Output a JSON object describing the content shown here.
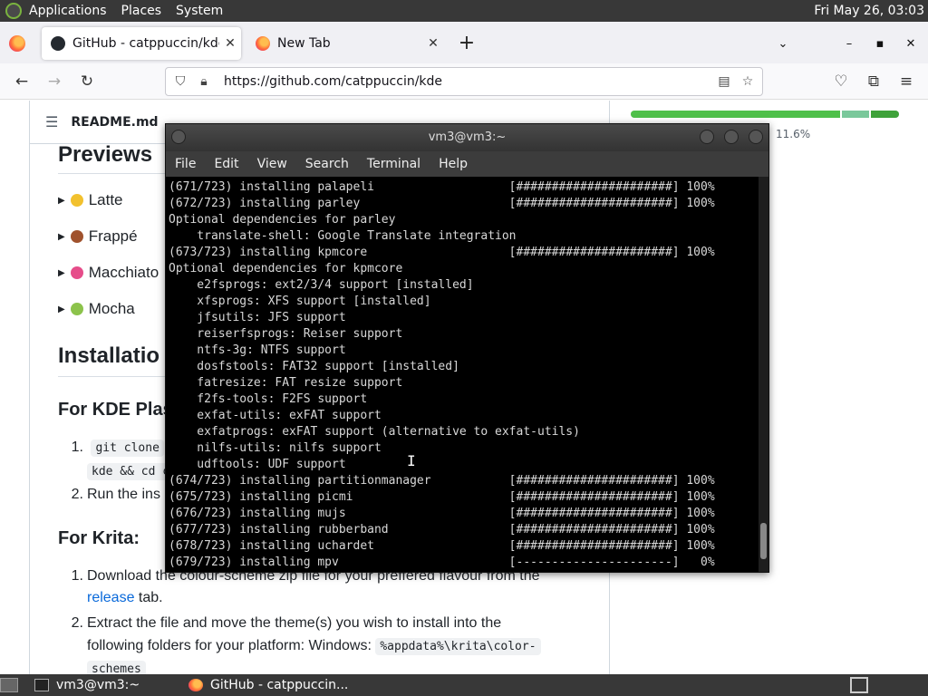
{
  "top_panel": {
    "menus": [
      "Applications",
      "Places",
      "System"
    ],
    "clock": "Fri May 26, 03:03"
  },
  "browser": {
    "tabs": [
      {
        "label": "GitHub - catppuccin/kde: 🌻",
        "active": true
      },
      {
        "label": "New Tab",
        "active": false
      }
    ],
    "url": "https://github.com/catppuccin/kde"
  },
  "readme": {
    "filename": "README.md",
    "progress_pct_text": "11.6%",
    "progress_segments": [
      {
        "color": "#4fc04a",
        "fraction": 0.78
      },
      {
        "color": "#7ac89b",
        "fraction": 0.11
      },
      {
        "color": "#3fa23a",
        "fraction": 0.11
      }
    ],
    "previews_heading": "Previews",
    "flavours": [
      {
        "name": "Latte",
        "emoji_color": "#f2c12e"
      },
      {
        "name": "Frappé",
        "emoji_color": "#a0522d"
      },
      {
        "name": "Macchiato",
        "emoji_color": "#e64d8a"
      },
      {
        "name": "Mocha",
        "emoji_color": "#8cc34b"
      }
    ],
    "installation_heading": "Installatio",
    "kde_heading": "For KDE Plas",
    "kde_steps": {
      "step1_num": "1.",
      "step1_code_a": "git clone",
      "step1_code_b": "kde && cd c",
      "step2_num": "2.",
      "step2_text": "Run the ins"
    },
    "krita_heading": "For Krita:",
    "krita_steps": {
      "step1_num": "1.",
      "step1_line1": "Download the colour-scheme zip file for your preffered flavour from the",
      "step1_link": "release",
      "step1_tail": " tab.",
      "step2_num": "2.",
      "step2_line1": "Extract the file and move the theme(s) you wish to install into the",
      "step2_line2": "following folders for your platform: Windows: ",
      "step2_code1": "%appdata%\\krita\\color-",
      "step2_code2": "schemes"
    }
  },
  "terminal": {
    "title": "vm3@vm3:~",
    "menus": [
      "File",
      "Edit",
      "View",
      "Search",
      "Terminal",
      "Help"
    ],
    "lines": [
      "(671/723) installing palapeli                   [######################] 100%",
      "(672/723) installing parley                     [######################] 100%",
      "Optional dependencies for parley",
      "    translate-shell: Google Translate integration",
      "(673/723) installing kpmcore                    [######################] 100%",
      "Optional dependencies for kpmcore",
      "    e2fsprogs: ext2/3/4 support [installed]",
      "    xfsprogs: XFS support [installed]",
      "    jfsutils: JFS support",
      "    reiserfsprogs: Reiser support",
      "    ntfs-3g: NTFS support",
      "    dosfstools: FAT32 support [installed]",
      "    fatresize: FAT resize support",
      "    f2fs-tools: F2FS support",
      "    exfat-utils: exFAT support",
      "    exfatprogs: exFAT support (alternative to exfat-utils)",
      "    nilfs-utils: nilfs support",
      "    udftools: UDF support",
      "(674/723) installing partitionmanager           [######################] 100%",
      "(675/723) installing picmi                      [######################] 100%",
      "(676/723) installing mujs                       [######################] 100%",
      "(677/723) installing rubberband                 [######################] 100%",
      "(678/723) installing uchardet                   [######################] 100%",
      "(679/723) installing mpv                        [----------------------]   0%"
    ]
  },
  "taskbar": {
    "items": [
      "vm3@vm3:~",
      "GitHub - catppuccin..."
    ]
  }
}
